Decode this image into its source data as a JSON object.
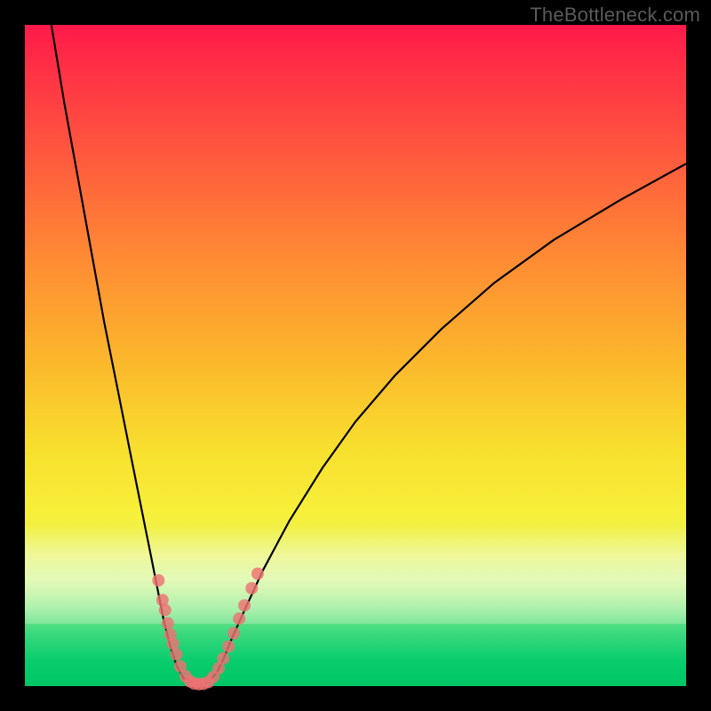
{
  "watermark": "TheBottleneck.com",
  "colors": {
    "top": "#ff1a4a",
    "mid": "#f8df2e",
    "bottom": "#00c665",
    "curve": "#000000",
    "marker": "#ed7373",
    "frame": "#000000"
  },
  "chart_data": {
    "type": "line",
    "title": "",
    "xlabel": "",
    "ylabel": "",
    "xlim": [
      0,
      100
    ],
    "ylim": [
      0,
      100
    ],
    "series": [
      {
        "name": "left-branch",
        "x": [
          4,
          6,
          8,
          10,
          12,
          14,
          16,
          18,
          19,
          20,
          21,
          22,
          23,
          24,
          25
        ],
        "y": [
          100,
          88,
          77,
          66,
          55,
          45,
          35,
          25,
          20,
          15,
          10,
          6,
          3,
          1.2,
          0.8
        ]
      },
      {
        "name": "bottom",
        "x": [
          25,
          25.5,
          26,
          26.5,
          27,
          27.5,
          28
        ],
        "y": [
          0.8,
          0.4,
          0.25,
          0.2,
          0.25,
          0.4,
          0.8
        ]
      },
      {
        "name": "right-branch",
        "x": [
          28,
          29,
          30,
          31,
          33,
          36,
          40,
          45,
          50,
          56,
          63,
          71,
          80,
          90,
          100
        ],
        "y": [
          0.8,
          2,
          4,
          6.5,
          11,
          17.5,
          25,
          33,
          40,
          47,
          54,
          61,
          67.5,
          73.5,
          79
        ]
      }
    ],
    "markers": [
      {
        "x": 20.2,
        "y": 16.0
      },
      {
        "x": 20.8,
        "y": 13.0
      },
      {
        "x": 21.2,
        "y": 11.5
      },
      {
        "x": 21.6,
        "y": 9.5
      },
      {
        "x": 22.0,
        "y": 7.8
      },
      {
        "x": 22.4,
        "y": 6.4
      },
      {
        "x": 22.9,
        "y": 4.8
      },
      {
        "x": 23.5,
        "y": 3.0
      },
      {
        "x": 24.3,
        "y": 1.5
      },
      {
        "x": 25.0,
        "y": 0.7
      },
      {
        "x": 25.6,
        "y": 0.4
      },
      {
        "x": 26.3,
        "y": 0.3
      },
      {
        "x": 27.0,
        "y": 0.35
      },
      {
        "x": 27.7,
        "y": 0.6
      },
      {
        "x": 28.5,
        "y": 1.4
      },
      {
        "x": 29.3,
        "y": 2.7
      },
      {
        "x": 30.0,
        "y": 4.2
      },
      {
        "x": 30.8,
        "y": 6.0
      },
      {
        "x": 31.6,
        "y": 8.0
      },
      {
        "x": 32.4,
        "y": 10.2
      },
      {
        "x": 33.2,
        "y": 12.2
      },
      {
        "x": 34.3,
        "y": 14.8
      },
      {
        "x": 35.2,
        "y": 17.0
      }
    ],
    "marker_radius": 7
  }
}
